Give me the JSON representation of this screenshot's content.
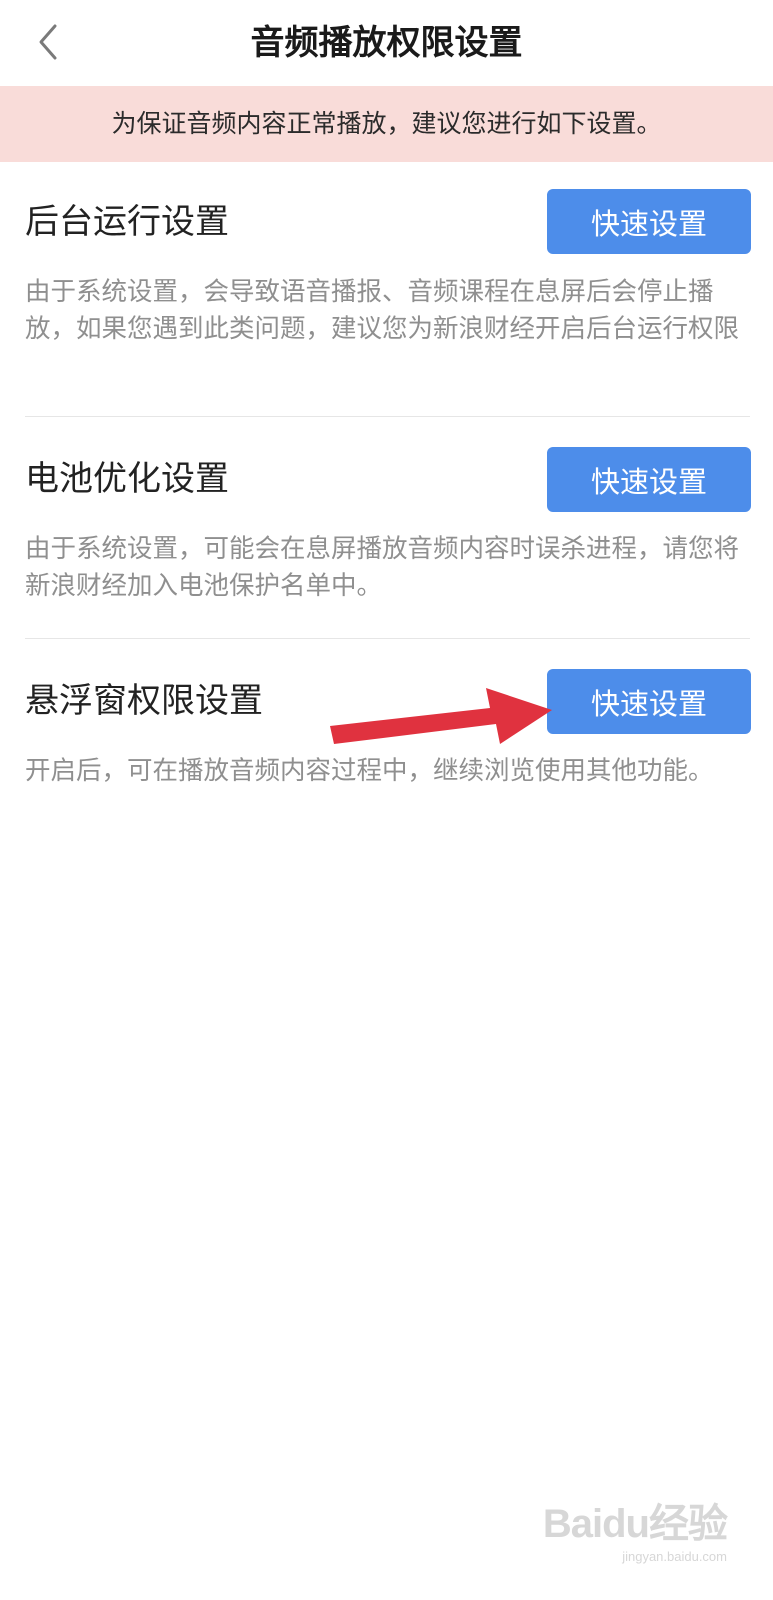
{
  "header": {
    "back_icon": "chevron-left-icon",
    "title": "音频播放权限设置"
  },
  "notice": {
    "text": "为保证音频内容正常播放，建议您进行如下设置。"
  },
  "sections": [
    {
      "title": "后台运行设置",
      "button_label": "快速设置",
      "description": "由于系统设置，会导致语音播报、音频课程在息屏后会停止播放，如果您遇到此类问题，建议您为新浪财经开启后台运行权限"
    },
    {
      "title": "电池优化设置",
      "button_label": "快速设置",
      "description": "由于系统设置，可能会在息屏播放音频内容时误杀进程，请您将新浪财经加入电池保护名单中。"
    },
    {
      "title": "悬浮窗权限设置",
      "button_label": "快速设置",
      "description": "开启后，可在播放音频内容过程中，继续浏览使用其他功能。"
    }
  ],
  "annotation": {
    "icon": "red-arrow-icon",
    "color": "#e0323f"
  },
  "watermark": {
    "logo": "Baidu经验",
    "url": "jingyan.baidu.com"
  },
  "colors": {
    "accent": "#4d8dea",
    "notice_bg": "#f9dcd9",
    "description": "#8f8f8f"
  }
}
